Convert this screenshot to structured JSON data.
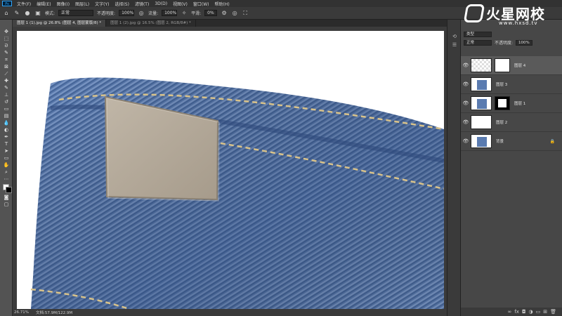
{
  "menubar": {
    "logo": "Ps",
    "items": [
      "文件(F)",
      "编辑(E)",
      "图像(I)",
      "图层(L)",
      "文字(Y)",
      "选择(S)",
      "滤镜(T)",
      "3D(D)",
      "视图(V)",
      "窗口(W)",
      "帮助(H)"
    ]
  },
  "options": {
    "mode_label": "模式:",
    "mode_value": "正常",
    "opacity_label": "不透明度:",
    "opacity_value": "100%",
    "flow_label": "流量:",
    "flow_value": "100%",
    "smooth_label": "平滑:",
    "smooth_value": "0%"
  },
  "tabs": [
    {
      "label": "图层 1 (1).jpg @ 26.8% (图层 4, 图层蒙版/8) *",
      "active": true
    },
    {
      "label": "图层 1 (2).jpg @ 16.5% (图层 2, RGB/8#) *",
      "active": false
    }
  ],
  "status": {
    "zoom": "26.71%",
    "doc": "文档:57.9M/122.9M"
  },
  "watermark": {
    "title": "火星网校",
    "url": "www.hxsd.tv"
  },
  "panel": {
    "kind_value": "类型",
    "blend_value": "正常",
    "opacity_label": "不透明度:",
    "opacity_value": "100%",
    "lock_label": "锁定:",
    "fill_label": "填充:",
    "fill_value": "100%",
    "layers": [
      {
        "name": "图层 4",
        "selected": true
      },
      {
        "name": "图层 3",
        "selected": false
      },
      {
        "name": "图层 1",
        "selected": false
      },
      {
        "name": "图层 2",
        "selected": false
      },
      {
        "name": "背景",
        "selected": false
      }
    ]
  },
  "colors": {
    "denim": "#5575a8",
    "patch": "#b3a898",
    "stitch": "#d8c28a",
    "accent": "#31a8ff"
  }
}
